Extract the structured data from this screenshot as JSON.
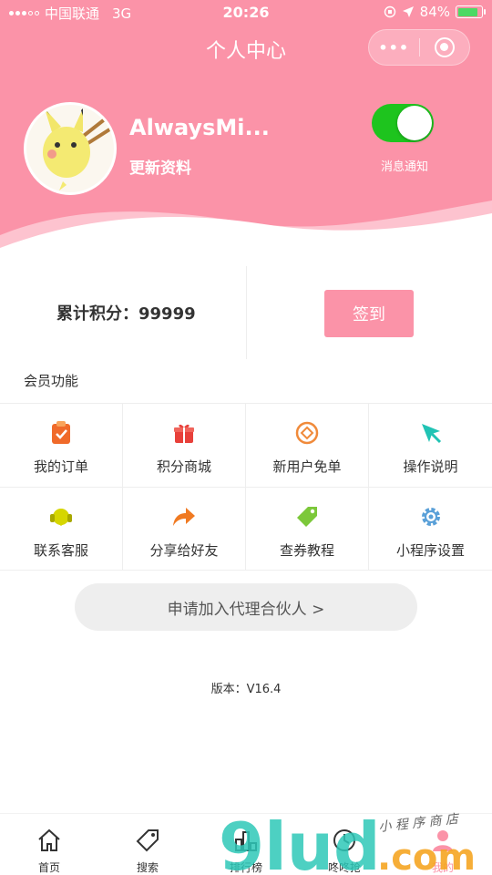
{
  "status_bar": {
    "carrier": "中国联通",
    "network": "3G",
    "time": "20:26",
    "battery": "84%",
    "battery_level": 0.84
  },
  "nav": {
    "title": "个人中心",
    "more_icon": "more-dots-icon",
    "close_icon": "target-circle-icon"
  },
  "profile": {
    "username": "AlwaysMi...",
    "edit_label": "更新资料",
    "notify_label": "消息通知",
    "notify_on": true
  },
  "points": {
    "label": "累计积分：99999",
    "checkin_label": "签到"
  },
  "section_title": "会员功能",
  "features": [
    {
      "label": "我的订单",
      "icon": "clipboard-check-icon",
      "color": "#f06a2a"
    },
    {
      "label": "积分商城",
      "icon": "gift-icon",
      "color": "#e8403a"
    },
    {
      "label": "新用户免单",
      "icon": "coin-icon",
      "color": "#f08a3a"
    },
    {
      "label": "操作说明",
      "icon": "compass-icon",
      "color": "#21c3b4"
    },
    {
      "label": "联系客服",
      "icon": "headset-icon",
      "color": "#d6d600"
    },
    {
      "label": "分享给好友",
      "icon": "share-arrow-icon",
      "color": "#f07a22"
    },
    {
      "label": "查券教程",
      "icon": "tag-icon",
      "color": "#7cc83a"
    },
    {
      "label": "小程序设置",
      "icon": "gear-icon",
      "color": "#5aa0d8"
    }
  ],
  "partner_button": "申请加入代理合伙人 >",
  "version": "版本：V16.4",
  "tabbar": {
    "items": [
      {
        "label": "首页",
        "icon": "home-icon"
      },
      {
        "label": "搜索",
        "icon": "tag-search-icon"
      },
      {
        "label": "排行榜",
        "icon": "ranking-icon"
      },
      {
        "label": "咚咚抢",
        "icon": "clock-icon"
      },
      {
        "label": "我的",
        "icon": "user-icon"
      }
    ],
    "active_index": 4
  },
  "watermark": {
    "brand": "9lud",
    "suffix": ".com",
    "tagline": "小 程 序 商 店"
  }
}
